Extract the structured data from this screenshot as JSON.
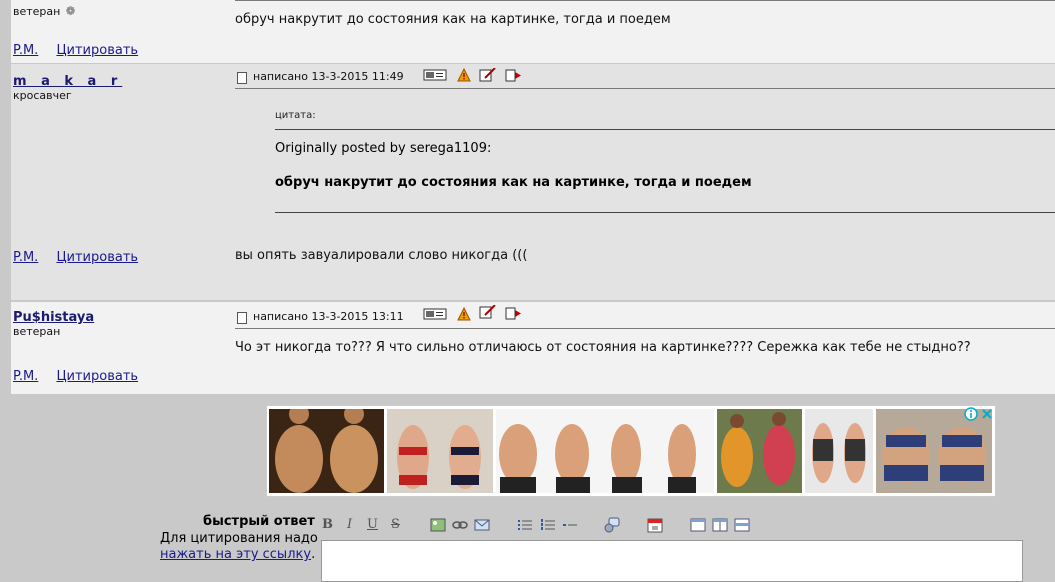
{
  "post1": {
    "rank": "ветеран",
    "body": "обруч накрутит до состояния как на картинке, тогда и поедем",
    "pm": "P.M.",
    "quote": "Цитировать"
  },
  "post2": {
    "author": "m a k a r",
    "rank": "кросавчег",
    "posted": "написано 13-3-2015 11:49",
    "quote_label": "цитата:",
    "quote_from": "Originally posted by serega1109:",
    "quote_text": "обруч накрутит до состояния как на картинке, тогда и поедем",
    "body": "вы опять завуалировали слово никогда (((",
    "pm": "P.M.",
    "quote": "Цитировать"
  },
  "post3": {
    "author": "Pu$histaya",
    "rank": "ветеран",
    "posted": "написано 13-3-2015 13:11",
    "body": "Чо эт никогда то??? Я что сильно отличаюсь от состояния на картинке???? Сережка как тебе не стыдно??",
    "pm": "P.M.",
    "quote": "Цитировать"
  },
  "reply": {
    "title": "быстрый ответ",
    "hint": "Для цитирования надо",
    "link": "нажать на эту ссылку",
    "dot": "."
  },
  "toolbar": {
    "bold": "B",
    "italic": "I",
    "underline": "U",
    "strike": "S"
  },
  "icons": [
    "profile-icon",
    "warn-icon",
    "edit-icon",
    "reply-icon",
    "settings-gear-icon",
    "adchoices-icon",
    "close-icon"
  ]
}
